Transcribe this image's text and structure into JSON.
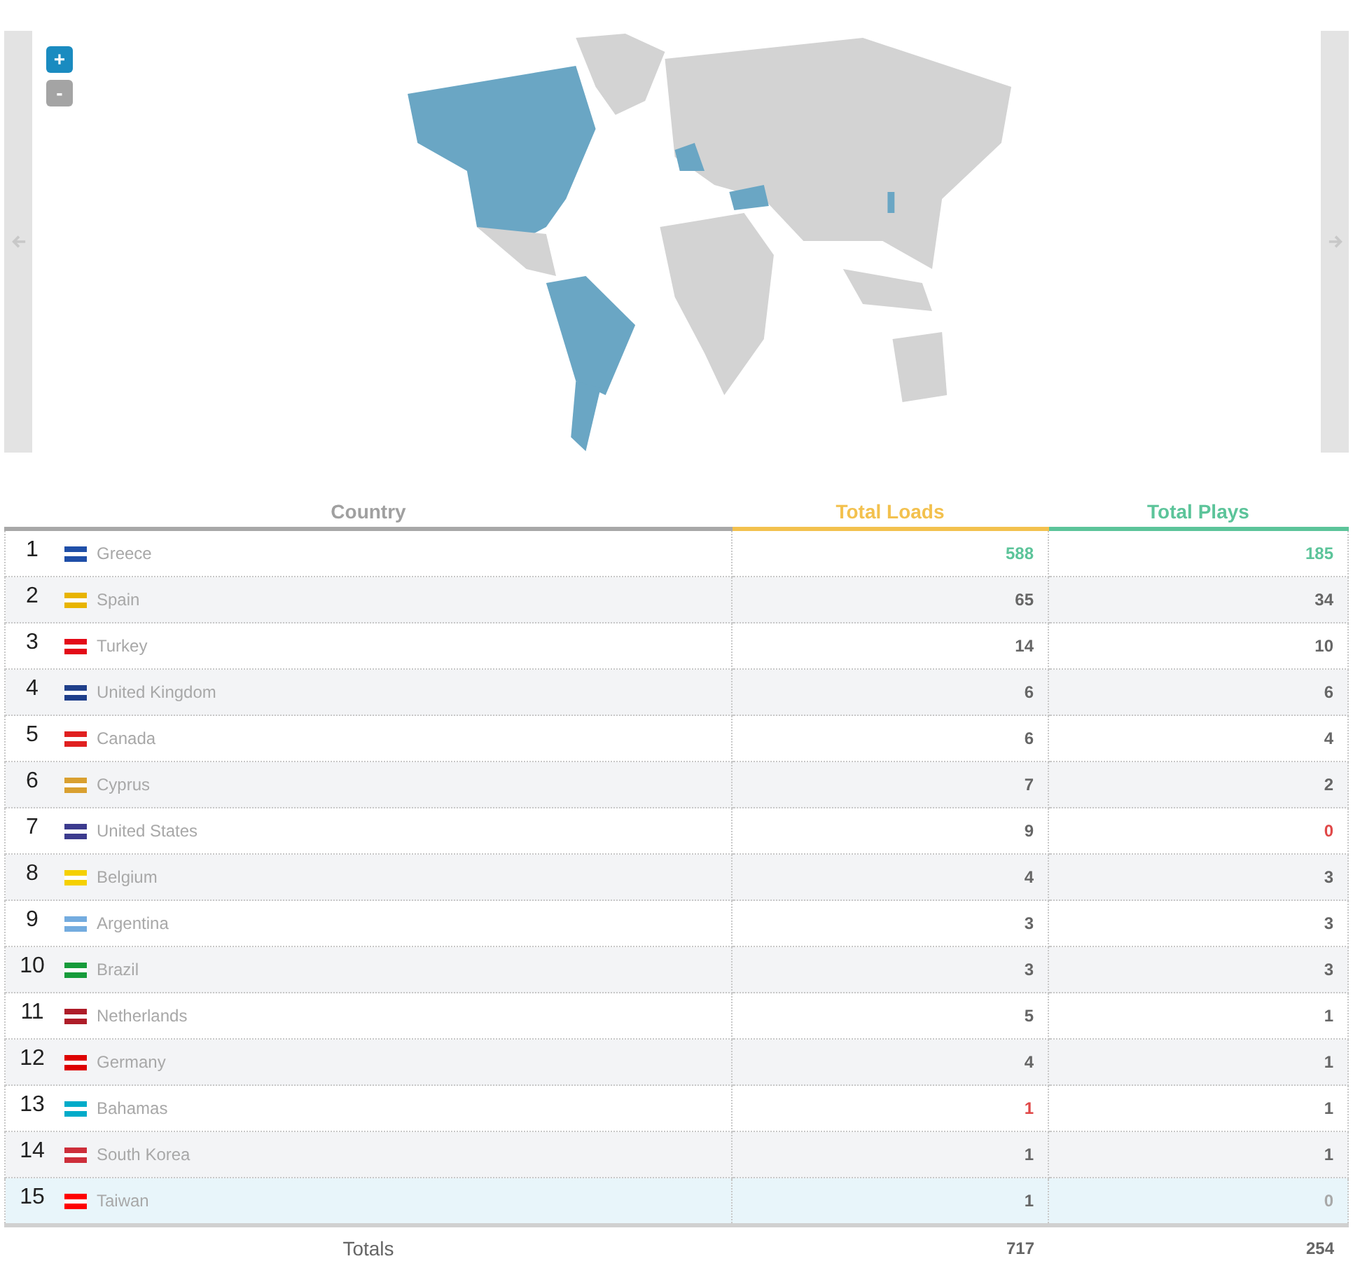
{
  "map": {
    "zoom_in": "+",
    "zoom_out": "-"
  },
  "table": {
    "columns": [
      "Country",
      "Total Loads",
      "Total Plays"
    ],
    "rows": [
      {
        "rank": "1",
        "country": "Greece",
        "color": "#1f4fa8",
        "loads": {
          "value": "588",
          "color": "#5cc49a"
        },
        "plays": {
          "value": "185",
          "color": "#5cc49a"
        },
        "selected": false
      },
      {
        "rank": "2",
        "country": "Spain",
        "color": "#e8b400",
        "loads": {
          "value": "65",
          "color": "#666666"
        },
        "plays": {
          "value": "34",
          "color": "#666666"
        },
        "selected": false
      },
      {
        "rank": "3",
        "country": "Turkey",
        "color": "#e30a17",
        "loads": {
          "value": "14",
          "color": "#666666"
        },
        "plays": {
          "value": "10",
          "color": "#666666"
        },
        "selected": false
      },
      {
        "rank": "4",
        "country": "United Kingdom",
        "color": "#1f3f8a",
        "loads": {
          "value": "6",
          "color": "#666666"
        },
        "plays": {
          "value": "6",
          "color": "#666666"
        },
        "selected": false
      },
      {
        "rank": "5",
        "country": "Canada",
        "color": "#e02020",
        "loads": {
          "value": "6",
          "color": "#666666"
        },
        "plays": {
          "value": "4",
          "color": "#666666"
        },
        "selected": false
      },
      {
        "rank": "6",
        "country": "Cyprus",
        "color": "#d9a030",
        "loads": {
          "value": "7",
          "color": "#666666"
        },
        "plays": {
          "value": "2",
          "color": "#666666"
        },
        "selected": false
      },
      {
        "rank": "7",
        "country": "United States",
        "color": "#3c3b8e",
        "loads": {
          "value": "9",
          "color": "#666666"
        },
        "plays": {
          "value": "0",
          "color": "#e04848"
        },
        "selected": false
      },
      {
        "rank": "8",
        "country": "Belgium",
        "color": "#f5d000",
        "loads": {
          "value": "4",
          "color": "#666666"
        },
        "plays": {
          "value": "3",
          "color": "#666666"
        },
        "selected": false
      },
      {
        "rank": "9",
        "country": "Argentina",
        "color": "#74acdf",
        "loads": {
          "value": "3",
          "color": "#666666"
        },
        "plays": {
          "value": "3",
          "color": "#666666"
        },
        "selected": false
      },
      {
        "rank": "10",
        "country": "Brazil",
        "color": "#169b3a",
        "loads": {
          "value": "3",
          "color": "#666666"
        },
        "plays": {
          "value": "3",
          "color": "#666666"
        },
        "selected": false
      },
      {
        "rank": "11",
        "country": "Netherlands",
        "color": "#ae1c28",
        "loads": {
          "value": "5",
          "color": "#666666"
        },
        "plays": {
          "value": "1",
          "color": "#666666"
        },
        "selected": false
      },
      {
        "rank": "12",
        "country": "Germany",
        "color": "#dd0000",
        "loads": {
          "value": "4",
          "color": "#666666"
        },
        "plays": {
          "value": "1",
          "color": "#666666"
        },
        "selected": false
      },
      {
        "rank": "13",
        "country": "Bahamas",
        "color": "#00abc9",
        "loads": {
          "value": "1",
          "color": "#e04848"
        },
        "plays": {
          "value": "1",
          "color": "#666666"
        },
        "selected": false
      },
      {
        "rank": "14",
        "country": "South Korea",
        "color": "#cd2e3a",
        "loads": {
          "value": "1",
          "color": "#666666"
        },
        "plays": {
          "value": "1",
          "color": "#666666"
        },
        "selected": false
      },
      {
        "rank": "15",
        "country": "Taiwan",
        "color": "#fe0000",
        "loads": {
          "value": "1",
          "color": "#666666"
        },
        "plays": {
          "value": "0",
          "color": "#a8a8a8"
        },
        "selected": true
      }
    ],
    "totals": {
      "label": "Totals",
      "loads": "717",
      "plays": "254"
    }
  }
}
